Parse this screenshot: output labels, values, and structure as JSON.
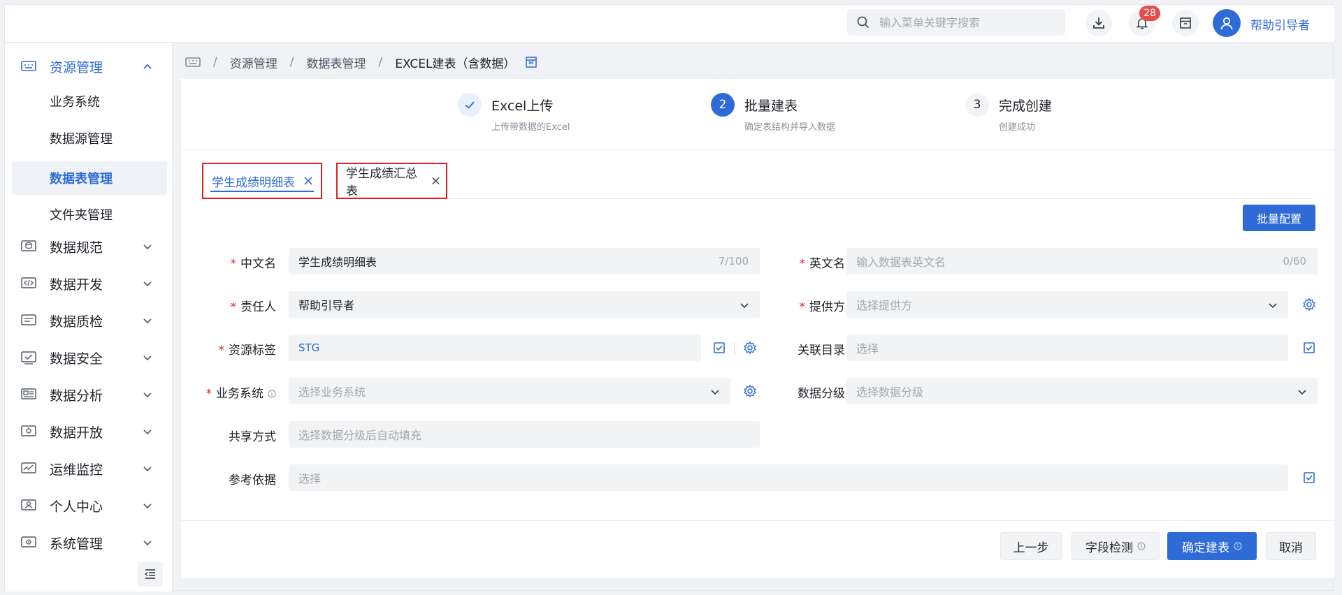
{
  "header": {
    "search_placeholder": "输入菜单关键字搜索",
    "notification_count": "28",
    "username": "帮助引导者"
  },
  "sidebar": {
    "items": [
      {
        "label": "资源管理",
        "icon": "keyboard-icon",
        "expanded": true
      },
      {
        "label": "数据规范",
        "icon": "stack-icon"
      },
      {
        "label": "数据开发",
        "icon": "code-icon"
      },
      {
        "label": "数据质检",
        "icon": "document-icon"
      },
      {
        "label": "数据安全",
        "icon": "checkmark-monitor-icon"
      },
      {
        "label": "数据分析",
        "icon": "analysis-icon"
      },
      {
        "label": "数据开放",
        "icon": "open-icon"
      },
      {
        "label": "运维监控",
        "icon": "monitor-chart-icon"
      },
      {
        "label": "个人中心",
        "icon": "user-icon"
      },
      {
        "label": "系统管理",
        "icon": "settings-monitor-icon"
      }
    ],
    "sub_items": [
      "业务系统",
      "数据源管理",
      "数据表管理",
      "文件夹管理"
    ],
    "active_sub": "数据表管理"
  },
  "breadcrumb": {
    "items": [
      "资源管理",
      "数据表管理",
      "EXCEL建表（含数据）"
    ],
    "separator": "/"
  },
  "steps": [
    {
      "index": "1",
      "title": "Excel上传",
      "desc": "上传带数据的Excel",
      "status": "done"
    },
    {
      "index": "2",
      "title": "批量建表",
      "desc": "确定表结构并导入数据",
      "status": "active"
    },
    {
      "index": "3",
      "title": "完成创建",
      "desc": "创建成功",
      "status": "wait"
    }
  ],
  "tabs": [
    {
      "label": "学生成绩明细表",
      "active": true
    },
    {
      "label": "学生成绩汇总表",
      "active": false
    }
  ],
  "batch_config_label": "批量配置",
  "form": {
    "cn_name": {
      "label": "中文名",
      "value": "学生成绩明细表",
      "count": "7/100"
    },
    "en_name": {
      "label": "英文名",
      "placeholder": "输入数据表英文名",
      "count": "0/60"
    },
    "owner": {
      "label": "责任人",
      "value": "帮助引导者"
    },
    "provider": {
      "label": "提供方",
      "placeholder": "选择提供方"
    },
    "resource_tag": {
      "label": "资源标签",
      "value": "STG"
    },
    "catalog": {
      "label": "关联目录",
      "placeholder": "选择"
    },
    "biz_system": {
      "label": "业务系统",
      "placeholder": "选择业务系统"
    },
    "data_level": {
      "label": "数据分级",
      "placeholder": "选择数据分级"
    },
    "share_mode": {
      "label": "共享方式",
      "placeholder": "选择数据分级后自动填充"
    },
    "reference": {
      "label": "参考依据",
      "placeholder": "选择"
    }
  },
  "footer": {
    "prev": "上一步",
    "check": "字段检测",
    "confirm": "确定建表",
    "cancel": "取消"
  },
  "colors": {
    "accent": "#2f6bd6",
    "danger": "#e02020",
    "badge": "#e34d4d"
  }
}
